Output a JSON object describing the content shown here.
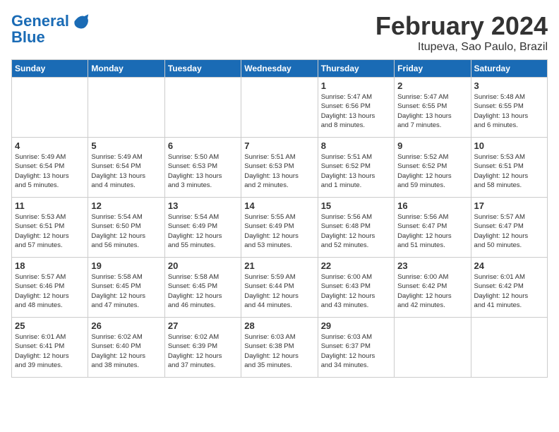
{
  "header": {
    "logo_line1": "General",
    "logo_line2": "Blue",
    "title": "February 2024",
    "subtitle": "Itupeva, Sao Paulo, Brazil"
  },
  "days_of_week": [
    "Sunday",
    "Monday",
    "Tuesday",
    "Wednesday",
    "Thursday",
    "Friday",
    "Saturday"
  ],
  "weeks": [
    [
      {
        "day": "",
        "info": ""
      },
      {
        "day": "",
        "info": ""
      },
      {
        "day": "",
        "info": ""
      },
      {
        "day": "",
        "info": ""
      },
      {
        "day": "1",
        "info": "Sunrise: 5:47 AM\nSunset: 6:56 PM\nDaylight: 13 hours\nand 8 minutes."
      },
      {
        "day": "2",
        "info": "Sunrise: 5:47 AM\nSunset: 6:55 PM\nDaylight: 13 hours\nand 7 minutes."
      },
      {
        "day": "3",
        "info": "Sunrise: 5:48 AM\nSunset: 6:55 PM\nDaylight: 13 hours\nand 6 minutes."
      }
    ],
    [
      {
        "day": "4",
        "info": "Sunrise: 5:49 AM\nSunset: 6:54 PM\nDaylight: 13 hours\nand 5 minutes."
      },
      {
        "day": "5",
        "info": "Sunrise: 5:49 AM\nSunset: 6:54 PM\nDaylight: 13 hours\nand 4 minutes."
      },
      {
        "day": "6",
        "info": "Sunrise: 5:50 AM\nSunset: 6:53 PM\nDaylight: 13 hours\nand 3 minutes."
      },
      {
        "day": "7",
        "info": "Sunrise: 5:51 AM\nSunset: 6:53 PM\nDaylight: 13 hours\nand 2 minutes."
      },
      {
        "day": "8",
        "info": "Sunrise: 5:51 AM\nSunset: 6:52 PM\nDaylight: 13 hours\nand 1 minute."
      },
      {
        "day": "9",
        "info": "Sunrise: 5:52 AM\nSunset: 6:52 PM\nDaylight: 12 hours\nand 59 minutes."
      },
      {
        "day": "10",
        "info": "Sunrise: 5:53 AM\nSunset: 6:51 PM\nDaylight: 12 hours\nand 58 minutes."
      }
    ],
    [
      {
        "day": "11",
        "info": "Sunrise: 5:53 AM\nSunset: 6:51 PM\nDaylight: 12 hours\nand 57 minutes."
      },
      {
        "day": "12",
        "info": "Sunrise: 5:54 AM\nSunset: 6:50 PM\nDaylight: 12 hours\nand 56 minutes."
      },
      {
        "day": "13",
        "info": "Sunrise: 5:54 AM\nSunset: 6:49 PM\nDaylight: 12 hours\nand 55 minutes."
      },
      {
        "day": "14",
        "info": "Sunrise: 5:55 AM\nSunset: 6:49 PM\nDaylight: 12 hours\nand 53 minutes."
      },
      {
        "day": "15",
        "info": "Sunrise: 5:56 AM\nSunset: 6:48 PM\nDaylight: 12 hours\nand 52 minutes."
      },
      {
        "day": "16",
        "info": "Sunrise: 5:56 AM\nSunset: 6:47 PM\nDaylight: 12 hours\nand 51 minutes."
      },
      {
        "day": "17",
        "info": "Sunrise: 5:57 AM\nSunset: 6:47 PM\nDaylight: 12 hours\nand 50 minutes."
      }
    ],
    [
      {
        "day": "18",
        "info": "Sunrise: 5:57 AM\nSunset: 6:46 PM\nDaylight: 12 hours\nand 48 minutes."
      },
      {
        "day": "19",
        "info": "Sunrise: 5:58 AM\nSunset: 6:45 PM\nDaylight: 12 hours\nand 47 minutes."
      },
      {
        "day": "20",
        "info": "Sunrise: 5:58 AM\nSunset: 6:45 PM\nDaylight: 12 hours\nand 46 minutes."
      },
      {
        "day": "21",
        "info": "Sunrise: 5:59 AM\nSunset: 6:44 PM\nDaylight: 12 hours\nand 44 minutes."
      },
      {
        "day": "22",
        "info": "Sunrise: 6:00 AM\nSunset: 6:43 PM\nDaylight: 12 hours\nand 43 minutes."
      },
      {
        "day": "23",
        "info": "Sunrise: 6:00 AM\nSunset: 6:42 PM\nDaylight: 12 hours\nand 42 minutes."
      },
      {
        "day": "24",
        "info": "Sunrise: 6:01 AM\nSunset: 6:42 PM\nDaylight: 12 hours\nand 41 minutes."
      }
    ],
    [
      {
        "day": "25",
        "info": "Sunrise: 6:01 AM\nSunset: 6:41 PM\nDaylight: 12 hours\nand 39 minutes."
      },
      {
        "day": "26",
        "info": "Sunrise: 6:02 AM\nSunset: 6:40 PM\nDaylight: 12 hours\nand 38 minutes."
      },
      {
        "day": "27",
        "info": "Sunrise: 6:02 AM\nSunset: 6:39 PM\nDaylight: 12 hours\nand 37 minutes."
      },
      {
        "day": "28",
        "info": "Sunrise: 6:03 AM\nSunset: 6:38 PM\nDaylight: 12 hours\nand 35 minutes."
      },
      {
        "day": "29",
        "info": "Sunrise: 6:03 AM\nSunset: 6:37 PM\nDaylight: 12 hours\nand 34 minutes."
      },
      {
        "day": "",
        "info": ""
      },
      {
        "day": "",
        "info": ""
      }
    ]
  ]
}
